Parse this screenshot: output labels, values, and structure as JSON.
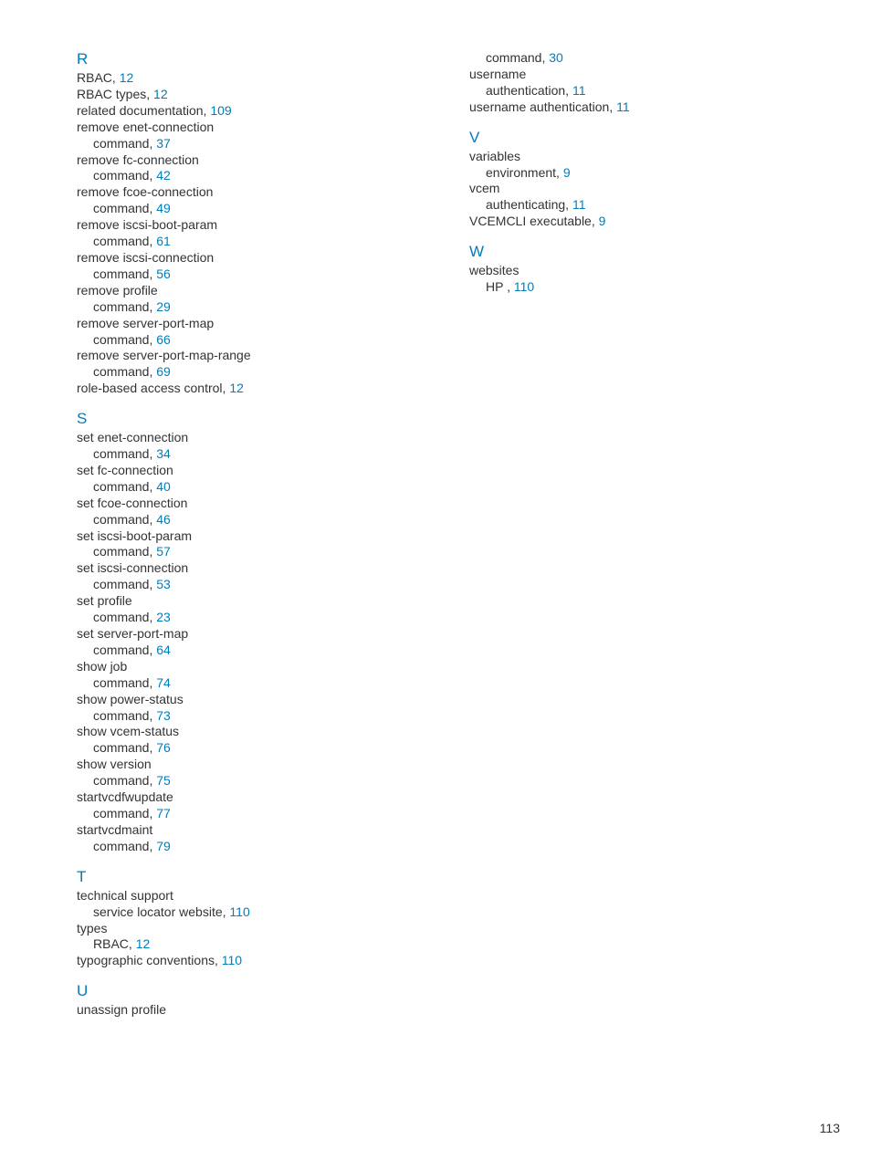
{
  "page_number": "113",
  "columns": [
    {
      "sections": [
        {
          "letter": "R",
          "first": true,
          "entries": [
            {
              "text": "RBAC, ",
              "page": "12"
            },
            {
              "text": "RBAC types, ",
              "page": "12"
            },
            {
              "text": "related documentation, ",
              "page": "109"
            },
            {
              "text": "remove enet-connection"
            },
            {
              "text": "command, ",
              "page": "37",
              "sub": true
            },
            {
              "text": "remove fc-connection"
            },
            {
              "text": "command, ",
              "page": "42",
              "sub": true
            },
            {
              "text": "remove fcoe-connection"
            },
            {
              "text": "command, ",
              "page": "49",
              "sub": true
            },
            {
              "text": "remove iscsi-boot-param"
            },
            {
              "text": "command, ",
              "page": "61",
              "sub": true
            },
            {
              "text": "remove iscsi-connection"
            },
            {
              "text": "command, ",
              "page": "56",
              "sub": true
            },
            {
              "text": "remove profile"
            },
            {
              "text": "command, ",
              "page": "29",
              "sub": true
            },
            {
              "text": "remove server-port-map"
            },
            {
              "text": "command, ",
              "page": "66",
              "sub": true
            },
            {
              "text": "remove server-port-map-range"
            },
            {
              "text": "command, ",
              "page": "69",
              "sub": true
            },
            {
              "text": "role-based access control, ",
              "page": "12"
            }
          ]
        },
        {
          "letter": "S",
          "entries": [
            {
              "text": "set enet-connection"
            },
            {
              "text": "command, ",
              "page": "34",
              "sub": true
            },
            {
              "text": "set fc-connection"
            },
            {
              "text": "command, ",
              "page": "40",
              "sub": true
            },
            {
              "text": "set fcoe-connection"
            },
            {
              "text": "command, ",
              "page": "46",
              "sub": true
            },
            {
              "text": "set iscsi-boot-param"
            },
            {
              "text": "command, ",
              "page": "57",
              "sub": true
            },
            {
              "text": "set iscsi-connection"
            },
            {
              "text": "command, ",
              "page": "53",
              "sub": true
            },
            {
              "text": "set profile"
            },
            {
              "text": "command, ",
              "page": "23",
              "sub": true
            },
            {
              "text": "set server-port-map"
            },
            {
              "text": "command, ",
              "page": "64",
              "sub": true
            },
            {
              "text": "show job"
            },
            {
              "text": "command, ",
              "page": "74",
              "sub": true
            },
            {
              "text": "show power-status"
            },
            {
              "text": "command, ",
              "page": "73",
              "sub": true
            },
            {
              "text": "show vcem-status"
            },
            {
              "text": "command, ",
              "page": "76",
              "sub": true
            },
            {
              "text": "show version"
            },
            {
              "text": "command, ",
              "page": "75",
              "sub": true
            },
            {
              "text": "startvcdfwupdate"
            },
            {
              "text": "command, ",
              "page": "77",
              "sub": true
            },
            {
              "text": "startvcdmaint"
            },
            {
              "text": "command, ",
              "page": "79",
              "sub": true
            }
          ]
        },
        {
          "letter": "T",
          "entries": [
            {
              "text": "technical support"
            },
            {
              "text": "service locator website, ",
              "page": "110",
              "sub": true
            },
            {
              "text": "types"
            },
            {
              "text": "RBAC, ",
              "page": "12",
              "sub": true
            },
            {
              "text": "typographic conventions, ",
              "page": "110"
            }
          ]
        },
        {
          "letter": "U",
          "entries": [
            {
              "text": "unassign profile"
            }
          ]
        }
      ]
    },
    {
      "sections": [
        {
          "entries": [
            {
              "text": "command, ",
              "page": "30",
              "sub": true
            },
            {
              "text": "username"
            },
            {
              "text": "authentication, ",
              "page": "11",
              "sub": true
            },
            {
              "text": "username authentication, ",
              "page": "11"
            }
          ]
        },
        {
          "letter": "V",
          "entries": [
            {
              "text": "variables"
            },
            {
              "text": "environment, ",
              "page": "9",
              "sub": true
            },
            {
              "text": "vcem"
            },
            {
              "text": "authenticating, ",
              "page": "11",
              "sub": true
            },
            {
              "text": "VCEMCLI executable, ",
              "page": "9"
            }
          ]
        },
        {
          "letter": "W",
          "entries": [
            {
              "text": "websites"
            },
            {
              "text": "HP , ",
              "page": "110",
              "sub": true
            }
          ]
        }
      ]
    }
  ]
}
